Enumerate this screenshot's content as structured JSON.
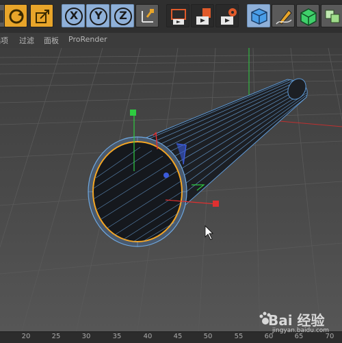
{
  "toolbar": {
    "items": [
      {
        "name": "render-settings-icon"
      },
      {
        "name": "refresh-live-select-icon"
      },
      {
        "name": "scale-tool-icon"
      },
      {
        "name": "x-axis-lock-button",
        "label": "X"
      },
      {
        "name": "y-axis-lock-button",
        "label": "Y"
      },
      {
        "name": "z-axis-lock-button",
        "label": "Z"
      },
      {
        "name": "coordinate-system-icon"
      },
      {
        "name": "render-view-icon"
      },
      {
        "name": "render-to-picture-viewer-icon"
      },
      {
        "name": "edit-render-settings-icon"
      },
      {
        "name": "cube-object-icon"
      },
      {
        "name": "pen-spline-icon"
      },
      {
        "name": "subdivision-surface-icon"
      },
      {
        "name": "array-generator-icon"
      }
    ]
  },
  "menubar": {
    "items": [
      "选项",
      "过滤",
      "面板",
      "ProRender"
    ]
  },
  "timeline": {
    "ticks": [
      "20",
      "25",
      "30",
      "35",
      "40",
      "45",
      "50",
      "55",
      "60",
      "65",
      "70"
    ]
  },
  "watermark": {
    "brand": "Bai 经验",
    "url": "jingyan.baidu.com"
  },
  "colors": {
    "accent_selected": "#8fb0d8",
    "viewport_bg": "#4c4c4c",
    "object_edge": "#6fa8e0",
    "selection_outline": "#f5a623",
    "axis_x": "#e03030",
    "axis_y": "#2ecc40",
    "axis_z": "#3b5bdb"
  }
}
